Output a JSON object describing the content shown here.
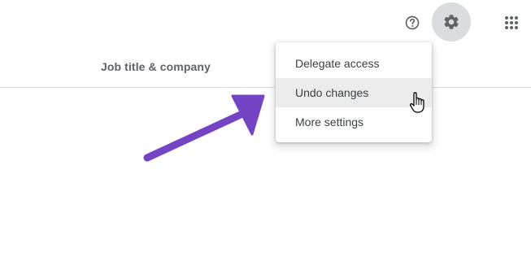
{
  "topbar": {
    "help_icon": "help-circle-icon",
    "settings_icon": "gear-icon",
    "apps_icon": "apps-grid-icon"
  },
  "table": {
    "column_header": "Job title & company"
  },
  "settings_menu": {
    "items": [
      {
        "label": "Delegate access"
      },
      {
        "label": "Undo changes"
      },
      {
        "label": "More settings"
      }
    ],
    "hovered_index": 1
  },
  "annotation": {
    "arrow_color": "#7444c4"
  },
  "colors": {
    "settings_active_bg": "#dadce0",
    "menu_hover_bg": "#ececec",
    "text": "#3c4043",
    "icon": "#5f6368"
  }
}
